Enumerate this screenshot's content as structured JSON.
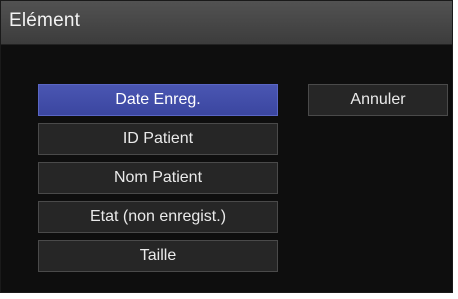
{
  "dialog": {
    "title": "Elément"
  },
  "options": [
    {
      "label": "Date Enreg.",
      "selected": true
    },
    {
      "label": "ID Patient",
      "selected": false
    },
    {
      "label": "Nom Patient",
      "selected": false
    },
    {
      "label": "Etat (non enregist.)",
      "selected": false
    },
    {
      "label": "Taille",
      "selected": false
    }
  ],
  "actions": {
    "cancel_label": "Annuler"
  },
  "colors": {
    "selected_bg": "#4150aa",
    "button_bg": "#262626",
    "dialog_bg": "#0e0e0e",
    "titlebar_bg": "#4a4a4a"
  }
}
